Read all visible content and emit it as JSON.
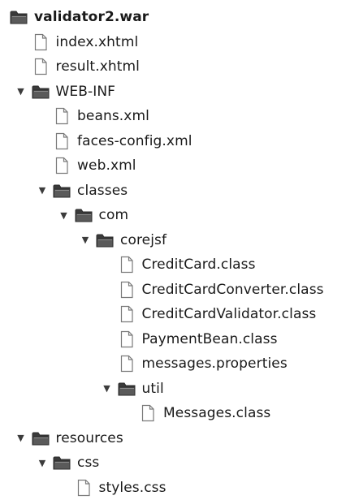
{
  "tree": {
    "items": [
      {
        "label": "validator2.war",
        "type": "folder",
        "depth": 0,
        "expanded": true,
        "toggle": false,
        "bold": true,
        "name": "tree-item-validator2-war"
      },
      {
        "label": "index.xhtml",
        "type": "file",
        "depth": 1,
        "name": "tree-item-index-xhtml"
      },
      {
        "label": "result.xhtml",
        "type": "file",
        "depth": 1,
        "name": "tree-item-result-xhtml"
      },
      {
        "label": "WEB-INF",
        "type": "folder",
        "depth": 1,
        "expanded": true,
        "toggle": true,
        "name": "tree-item-web-inf"
      },
      {
        "label": "beans.xml",
        "type": "file",
        "depth": 2,
        "name": "tree-item-beans-xml"
      },
      {
        "label": "faces-config.xml",
        "type": "file",
        "depth": 2,
        "name": "tree-item-faces-config-xml"
      },
      {
        "label": "web.xml",
        "type": "file",
        "depth": 2,
        "name": "tree-item-web-xml"
      },
      {
        "label": "classes",
        "type": "folder",
        "depth": 2,
        "expanded": true,
        "toggle": true,
        "name": "tree-item-classes"
      },
      {
        "label": "com",
        "type": "folder",
        "depth": 3,
        "expanded": true,
        "toggle": true,
        "name": "tree-item-com"
      },
      {
        "label": "corejsf",
        "type": "folder",
        "depth": 4,
        "expanded": true,
        "toggle": true,
        "name": "tree-item-corejsf"
      },
      {
        "label": "CreditCard.class",
        "type": "file",
        "depth": 5,
        "name": "tree-item-creditcard-class"
      },
      {
        "label": "CreditCardConverter.class",
        "type": "file",
        "depth": 5,
        "name": "tree-item-creditcardconverter-class"
      },
      {
        "label": "CreditCardValidator.class",
        "type": "file",
        "depth": 5,
        "name": "tree-item-creditcardvalidator-class"
      },
      {
        "label": "PaymentBean.class",
        "type": "file",
        "depth": 5,
        "name": "tree-item-paymentbean-class"
      },
      {
        "label": "messages.properties",
        "type": "file",
        "depth": 5,
        "name": "tree-item-messages-properties"
      },
      {
        "label": "util",
        "type": "folder",
        "depth": 5,
        "expanded": true,
        "toggle": true,
        "name": "tree-item-util"
      },
      {
        "label": "Messages.class",
        "type": "file",
        "depth": 6,
        "name": "tree-item-messages-class"
      },
      {
        "label": "resources",
        "type": "folder",
        "depth": 1,
        "expanded": true,
        "toggle": true,
        "name": "tree-item-resources"
      },
      {
        "label": "css",
        "type": "folder",
        "depth": 2,
        "expanded": true,
        "toggle": true,
        "name": "tree-item-css"
      },
      {
        "label": "styles.css",
        "type": "file",
        "depth": 3,
        "name": "tree-item-styles-css"
      }
    ]
  },
  "icons": {
    "folder": "folder-icon",
    "file": "file-icon",
    "expanded": "expanded-arrow-icon"
  },
  "colors": {
    "folder_body": "#5a5a5a",
    "folder_tab": "#3a3a3a",
    "file_stroke": "#7a7a7a",
    "file_fill": "#ffffff",
    "text": "#1a1a1a"
  }
}
